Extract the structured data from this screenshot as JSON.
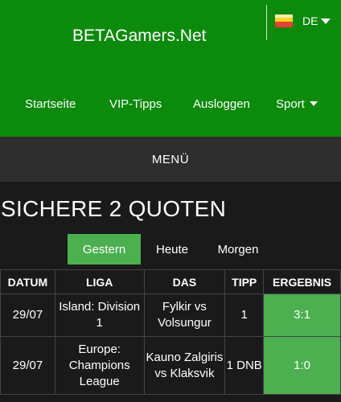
{
  "header": {
    "brand": "BETAGamers.Net",
    "language": "DE",
    "nav": [
      {
        "label": "Startseite"
      },
      {
        "label": "VIP-Tipps"
      },
      {
        "label": "Ausloggen"
      },
      {
        "label": "Sport"
      }
    ]
  },
  "menu_label": "MENÜ",
  "page_title": "SICHERE 2 QUOTEN",
  "tabs": [
    {
      "label": "Gestern",
      "active": true
    },
    {
      "label": "Heute",
      "active": false
    },
    {
      "label": "Morgen",
      "active": false
    }
  ],
  "table": {
    "headers": [
      "DATUM",
      "LIGA",
      "DAS",
      "TIPP",
      "ERGEBNIS"
    ],
    "rows": [
      {
        "datum": "29/07",
        "liga": "Island: Division 1",
        "das": "Fylkir vs Volsungur",
        "tipp": "1",
        "ergebnis": "3:1"
      },
      {
        "datum": "29/07",
        "liga": "Europe: Champions League",
        "das": "Kauno Zalgiris vs Klaksvik",
        "tipp": "1 DNB",
        "ergebnis": "1:0"
      }
    ]
  },
  "colors": {
    "header_green": "#0b8a0b",
    "accent_green": "#4caf50",
    "menubar": "#2e2e2e",
    "background": "#1a1a1a"
  }
}
